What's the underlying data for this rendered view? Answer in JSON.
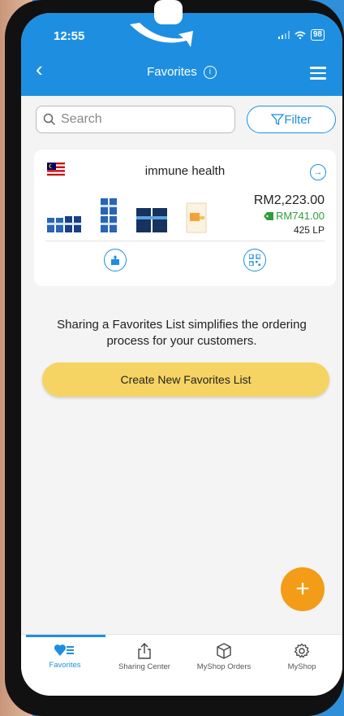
{
  "status_bar": {
    "time": "12:55",
    "battery": "98"
  },
  "header": {
    "title": "Favorites",
    "info_glyph": "i"
  },
  "search": {
    "placeholder": "Search"
  },
  "filter": {
    "label": "Filter"
  },
  "favorites_list": [
    {
      "name": "immune health",
      "country_flag": "malaysia-flag-icon",
      "price": "RM2,223.00",
      "discount": "RM741.00",
      "lp": "425 LP"
    }
  ],
  "message": "Sharing a Favorites List simplifies the ordering process for your customers.",
  "create_button": {
    "label": "Create New Favorites List"
  },
  "fab": {
    "label": "+"
  },
  "tabs": [
    {
      "label": "Favorites",
      "icon": "heart-list-icon",
      "active": true
    },
    {
      "label": "Sharing Center",
      "icon": "share-icon",
      "active": false
    },
    {
      "label": "MyShop Orders",
      "icon": "box-icon",
      "active": false
    },
    {
      "label": "MyShop",
      "icon": "gear-icon",
      "active": false
    }
  ],
  "colors": {
    "primary": "#1e8fe0",
    "accent": "#f6d463",
    "fab": "#f39c17",
    "discount": "#2e9e3a"
  }
}
